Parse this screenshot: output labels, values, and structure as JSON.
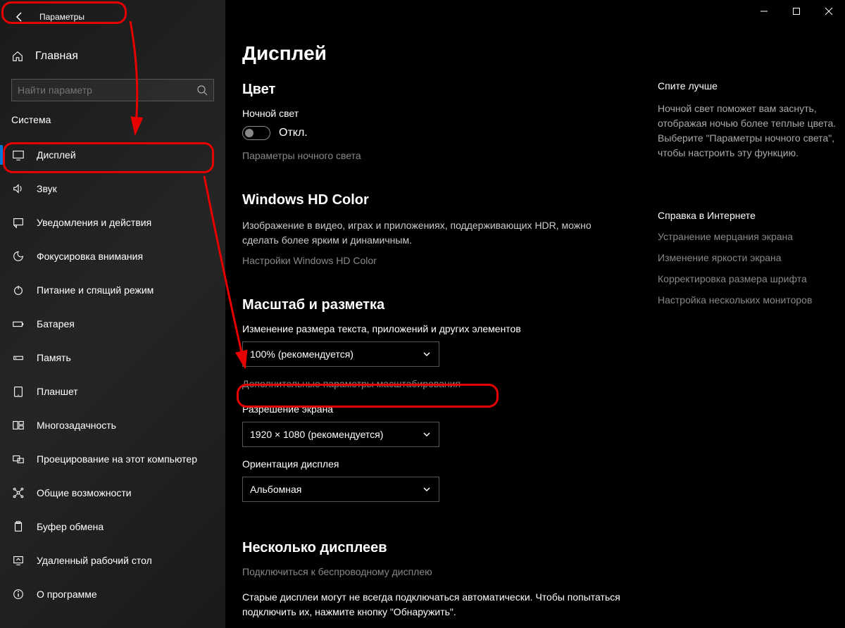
{
  "titlebar": {
    "title": "Параметры"
  },
  "sidebar": {
    "home": "Главная",
    "search_placeholder": "Найти параметр",
    "section": "Система",
    "items": [
      {
        "label": "Дисплей"
      },
      {
        "label": "Звук"
      },
      {
        "label": "Уведомления и действия"
      },
      {
        "label": "Фокусировка внимания"
      },
      {
        "label": "Питание и спящий режим"
      },
      {
        "label": "Батарея"
      },
      {
        "label": "Память"
      },
      {
        "label": "Планшет"
      },
      {
        "label": "Многозадачность"
      },
      {
        "label": "Проецирование на этот компьютер"
      },
      {
        "label": "Общие возможности"
      },
      {
        "label": "Буфер обмена"
      },
      {
        "label": "Удаленный рабочий стол"
      },
      {
        "label": "О программе"
      }
    ]
  },
  "main": {
    "title": "Дисплей",
    "color": {
      "heading": "Цвет",
      "night_light_label": "Ночной свет",
      "night_light_state": "Откл.",
      "night_light_settings": "Параметры ночного света"
    },
    "hd": {
      "heading": "Windows HD Color",
      "desc": "Изображение в видео, играх и приложениях, поддерживающих HDR, можно сделать более ярким и динамичным.",
      "link": "Настройки Windows HD Color"
    },
    "scale": {
      "heading": "Масштаб и разметка",
      "size_label": "Изменение размера текста, приложений и других элементов",
      "size_value": "100% (рекомендуется)",
      "advanced_link": "Дополнительные параметры масштабирования",
      "resolution_label": "Разрешение экрана",
      "resolution_value": "1920 × 1080 (рекомендуется)",
      "orientation_label": "Ориентация дисплея",
      "orientation_value": "Альбомная"
    },
    "multi": {
      "heading": "Несколько дисплеев",
      "wireless_link": "Подключиться к беспроводному дисплею",
      "old_desc": "Старые дисплеи могут не всегда подключаться автоматически. Чтобы попытаться подключить их, нажмите кнопку \"Обнаружить\"."
    }
  },
  "right": {
    "sleep_heading": "Спите лучше",
    "sleep_desc": "Ночной свет поможет вам заснуть, отображая ночью более теплые цвета. Выберите \"Параметры ночного света\", чтобы настроить эту функцию.",
    "help_heading": "Справка в Интернете",
    "links": [
      "Устранение мерцания экрана",
      "Изменение яркости экрана",
      "Корректировка размера шрифта",
      "Настройка нескольких мониторов"
    ]
  }
}
